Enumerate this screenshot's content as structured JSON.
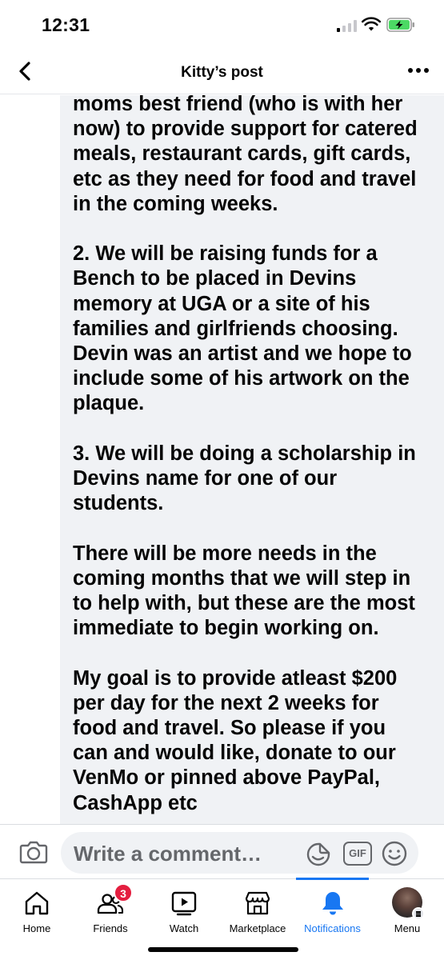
{
  "status_bar": {
    "time": "12:31"
  },
  "header": {
    "title": "Kitty’s post",
    "back_icon": "chevron-left-icon",
    "more_icon": "more-horizontal-icon"
  },
  "post": {
    "text": "moms best friend (who is with her\nnow) to provide support for catered\nmeals, restaurant cards, gift cards,\netc as they need for food and travel\nin the coming weeks.\n\n2. We will be raising funds for a\nBench to be placed in Devins\nmemory at UGA or a site of his\nfamilies and girlfriends choosing.\nDevin was an artist and we hope to\ninclude some of his artwork on the\nplaque.\n\n3. We will be doing a scholarship in\nDevins name for one of our\nstudents.\n\nThere will be more needs in the\ncoming months that we will step in\nto help with, but these are the most\nimmediate to begin working on.\n\nMy goal is to provide atleast $200\nper day for the next 2 weeks for\nfood and travel. So please if you\ncan and would like, donate to our\nVenMo or pinned above PayPal,\nCashApp etc"
  },
  "comment_bar": {
    "placeholder": "Write a comment…",
    "gif_label": "GIF"
  },
  "tabs": [
    {
      "label": "Home",
      "icon": "home-icon"
    },
    {
      "label": "Friends",
      "icon": "friends-icon",
      "badge": "3"
    },
    {
      "label": "Watch",
      "icon": "watch-icon"
    },
    {
      "label": "Marketplace",
      "icon": "marketplace-icon"
    },
    {
      "label": "Notifications",
      "icon": "bell-icon",
      "active": true
    },
    {
      "label": "Menu",
      "icon": "avatar"
    }
  ],
  "colors": {
    "accent": "#1877f2",
    "badge": "#e41e3f",
    "battery": "#4cd964",
    "bubble": "#f0f2f5",
    "secondary_text": "#65676b"
  }
}
